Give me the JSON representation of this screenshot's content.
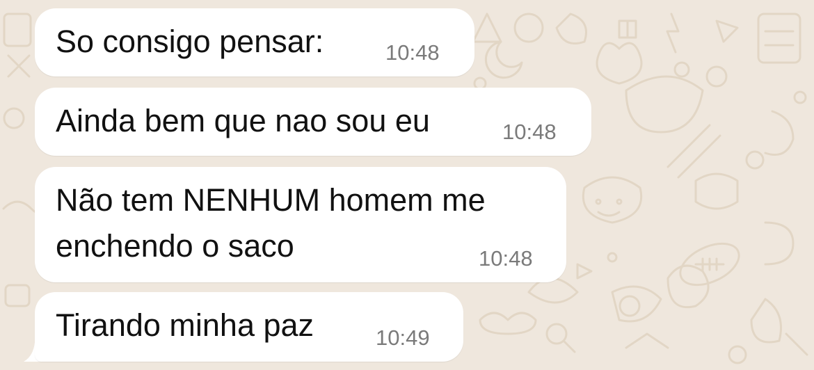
{
  "chat": {
    "messages": [
      {
        "text_lines": [
          "So consigo pensar:"
        ],
        "time": "10:48"
      },
      {
        "text_lines": [
          "Ainda bem que nao sou eu"
        ],
        "time": "10:48"
      },
      {
        "text_lines": [
          "Não tem NENHUM homem me",
          "enchendo o saco"
        ],
        "time": "10:48"
      },
      {
        "text_lines": [
          "Tirando minha paz"
        ],
        "time": "10:49"
      }
    ]
  },
  "colors": {
    "background": "#efe7dd",
    "bubble": "#ffffff",
    "text": "#111111",
    "timestamp": "#7a7a7a",
    "doodle": "#e3d8c8"
  },
  "icons": [
    "doodle-wallpaper"
  ]
}
